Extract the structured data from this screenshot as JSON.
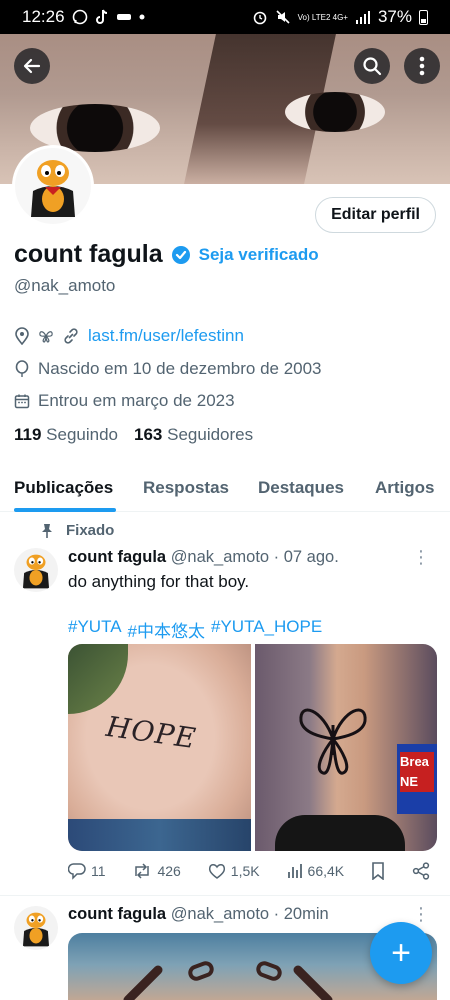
{
  "status_bar": {
    "time": "12:26",
    "network": "Vo) LTE2 4G+",
    "battery": "37%"
  },
  "profile": {
    "display_name": "count fagula",
    "verify_label": "Seja verificado",
    "handle": "@nak_amoto",
    "edit_button": "Editar perfil",
    "link": "last.fm/user/lefestinn",
    "birthday": "Nascido em 10 de dezembro de 2003",
    "joined": "Entrou em março de 2023",
    "following_count": "119",
    "following_label": "Seguindo",
    "followers_count": "163",
    "followers_label": "Seguidores"
  },
  "tabs": [
    "Publicações",
    "Respostas",
    "Destaques",
    "Artigos"
  ],
  "pinned_label": "Fixado",
  "post1": {
    "name": "count fagula",
    "meta": "@nak_amoto · 07 ago.",
    "text": "do anything for that boy.",
    "hashtags": [
      "#YUTA",
      "#中本悠太",
      "#YUTA_HOPE"
    ],
    "tattoo_text": "HOPE",
    "sign_text": "Brea NE",
    "replies": "11",
    "reposts": "426",
    "likes": "1,5K",
    "views": "66,4K"
  },
  "post2": {
    "name": "count fagula",
    "meta": "@nak_amoto · 20min"
  },
  "fab_label": "+",
  "colors": {
    "accent": "#1d9bf0",
    "text": "#0f1419",
    "muted": "#536471"
  }
}
